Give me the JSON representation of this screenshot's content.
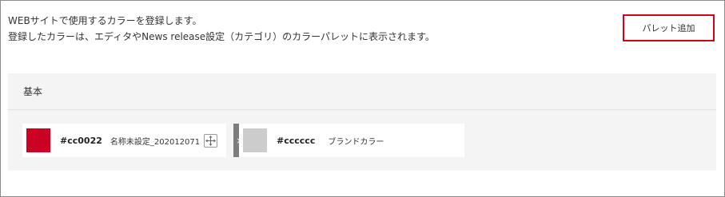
{
  "description": {
    "line1": "WEBサイトで使用するカラーを登録します。",
    "line2": "登録したカラーは、エディタやNews release設定（カテゴリ）のカラーパレットに表示されます。"
  },
  "toolbar": {
    "add_palette_label": "パレット追加",
    "add_palette_border_color": "#d0021b"
  },
  "palette_group": {
    "title": "基本",
    "colors": [
      {
        "hex": "#cc0022",
        "name": "名称未設定_202012071",
        "swatch": "#cc0022"
      },
      {
        "hex": "#cccccc",
        "name": "ブランドカラー",
        "swatch": "#cccccc"
      }
    ],
    "move_icon": "move-arrows-icon",
    "delete_icon": "close-icon",
    "delete_glyph": "×"
  }
}
